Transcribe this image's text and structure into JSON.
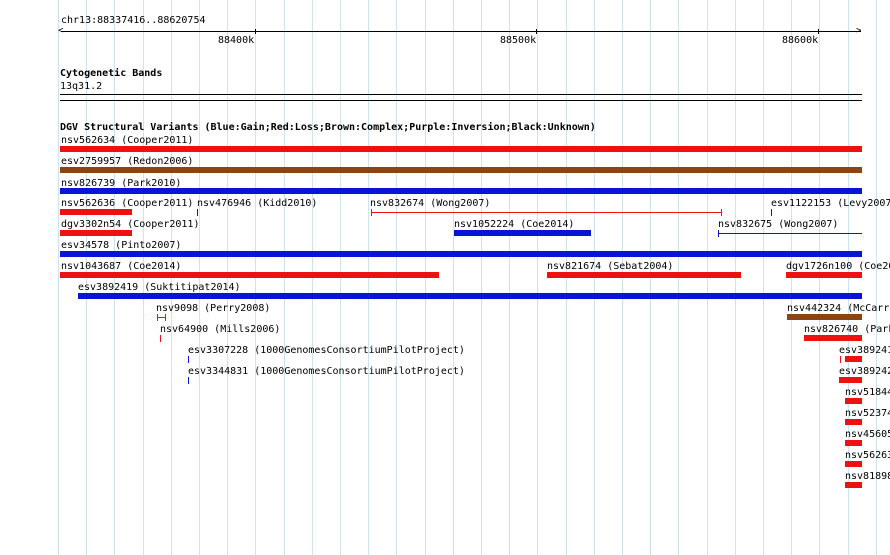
{
  "ruler": {
    "region": "chr13:88337416..88620754",
    "ticks": [
      "88400k",
      "88500k",
      "88600k"
    ]
  },
  "cyto": {
    "title": "Cytogenetic Bands",
    "band": "13q31.2"
  },
  "dgv": {
    "title": "DGV Structural Variants (Blue:Gain;Red:Loss;Brown:Complex;Purple:Inversion;Black:Unknown)"
  },
  "colors": {
    "gain": "#0a14d6",
    "loss": "#ee1111",
    "complex": "#8b4513",
    "grid": "#cfe3ee"
  },
  "variants": [
    {
      "id": "nsv562634 (Cooper2011)"
    },
    {
      "id": "esv2759957 (Redon2006)"
    },
    {
      "id": "nsv826739 (Park2010)"
    },
    {
      "id": "nsv562636 (Cooper2011)"
    },
    {
      "id": "nsv476946 (Kidd2010)"
    },
    {
      "id": "nsv832674 (Wong2007)"
    },
    {
      "id": "esv1122153 (Levy2007"
    },
    {
      "id": "dgv3302n54 (Cooper2011)"
    },
    {
      "id": "nsv1052224 (Coe2014)"
    },
    {
      "id": "nsv832675 (Wong2007)"
    },
    {
      "id": "esv34578 (Pinto2007)"
    },
    {
      "id": "nsv1043687 (Coe2014)"
    },
    {
      "id": "nsv821674 (Sebat2004)"
    },
    {
      "id": "dgv1726n100 (Coe20"
    },
    {
      "id": "esv3892419 (Suktitipat2014)"
    },
    {
      "id": "nsv9098 (Perry2008)"
    },
    {
      "id": "nsv442324 (McCarro"
    },
    {
      "id": "nsv64900 (Mills2006)"
    },
    {
      "id": "nsv826740 (Park"
    },
    {
      "id": "esv3307228 (1000GenomesConsortiumPilotProject)"
    },
    {
      "id": "esv389241"
    },
    {
      "id": "esv3344831 (1000GenomesConsortiumPilotProject)"
    },
    {
      "id": "esv389242"
    },
    {
      "id": "nsv51844"
    },
    {
      "id": "nsv52374"
    },
    {
      "id": "nsv45605"
    },
    {
      "id": "nsv56263"
    },
    {
      "id": "nsv81898"
    }
  ]
}
